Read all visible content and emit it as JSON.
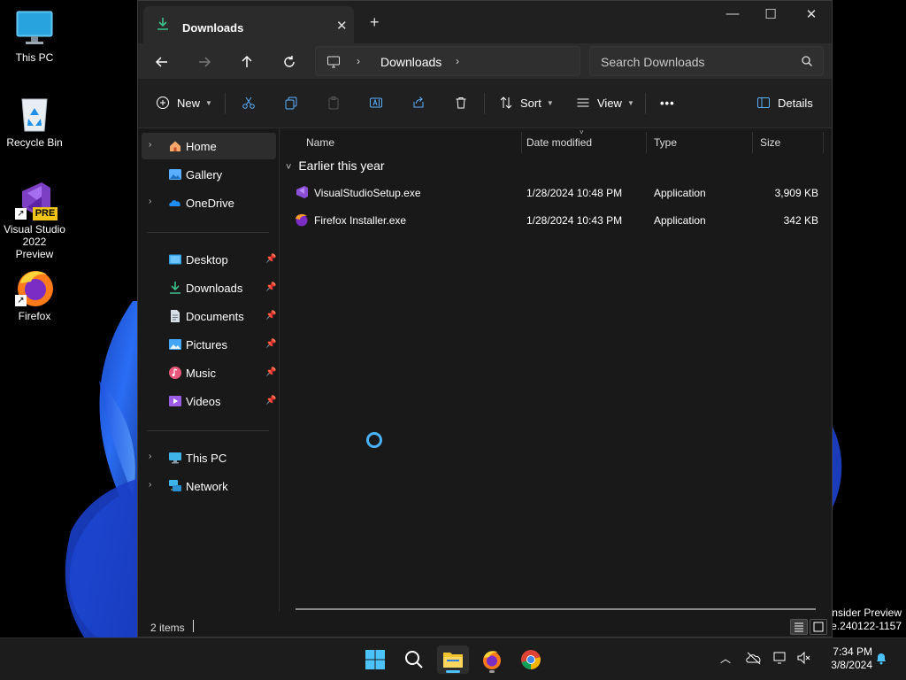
{
  "desktop": {
    "icons": [
      {
        "label": "This PC"
      },
      {
        "label": "Recycle Bin"
      },
      {
        "label": "Visual Studio\n2022 Preview",
        "line1": "Visual Studio",
        "line2": "2022 Preview",
        "badge": "PRE"
      },
      {
        "label": "Firefox"
      }
    ],
    "watermark": {
      "line1": "Insider Preview",
      "line2": "se.240122-1157"
    }
  },
  "window": {
    "tab_title": "Downloads",
    "address": {
      "location": "Downloads"
    },
    "search": {
      "placeholder": "Search Downloads"
    },
    "toolbar": {
      "new_label": "New",
      "sort_label": "Sort",
      "view_label": "View",
      "more_label": "•••",
      "details_label": "Details"
    },
    "nav": {
      "top": [
        {
          "label": "Home",
          "selected": true,
          "expandable": true
        },
        {
          "label": "Gallery",
          "expandable": false
        },
        {
          "label": "OneDrive",
          "expandable": true
        }
      ],
      "quick": [
        {
          "label": "Desktop"
        },
        {
          "label": "Downloads"
        },
        {
          "label": "Documents"
        },
        {
          "label": "Pictures"
        },
        {
          "label": "Music"
        },
        {
          "label": "Videos"
        }
      ],
      "bottom": [
        {
          "label": "This PC"
        },
        {
          "label": "Network"
        }
      ]
    },
    "columns": [
      "Name",
      "Date modified",
      "Type",
      "Size"
    ],
    "group_label": "Earlier this year",
    "files": [
      {
        "name": "VisualStudioSetup.exe",
        "date": "1/28/2024 10:48 PM",
        "type": "Application",
        "size": "3,909 KB"
      },
      {
        "name": "Firefox Installer.exe",
        "date": "1/28/2024 10:43 PM",
        "type": "Application",
        "size": "342 KB"
      }
    ],
    "status": {
      "item_count": "2 items"
    }
  },
  "taskbar": {
    "clock": {
      "time": "7:34 PM",
      "date": "3/8/2024"
    }
  },
  "colors": {
    "accent": "#4ab2ff",
    "window_bg": "#191919",
    "toolbar_bg": "#202020",
    "taskbar_bg": "#1c1c1c"
  }
}
